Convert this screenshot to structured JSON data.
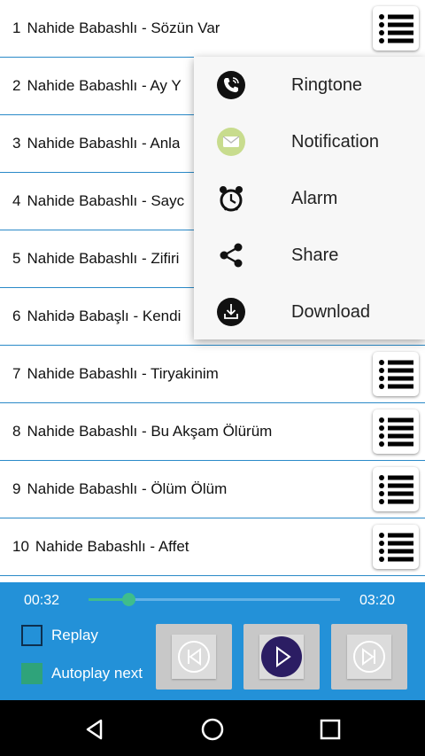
{
  "songs": [
    {
      "num": "1",
      "title": "Nahide Babashlı - Sözün Var"
    },
    {
      "num": "2",
      "title": "Nahide Babashlı - Ay Y"
    },
    {
      "num": "3",
      "title": "Nahide Babashlı - Anla"
    },
    {
      "num": "4",
      "title": "Nahide Babashlı - Sayc"
    },
    {
      "num": "5",
      "title": "Nahide Babashlı - Zifiri"
    },
    {
      "num": "6",
      "title": "Nahidə Babaşlı - Kendi"
    },
    {
      "num": "7",
      "title": "Nahide Babashlı - Tiryakinim"
    },
    {
      "num": "8",
      "title": "Nahide Babashlı - Bu Akşam Ölürüm"
    },
    {
      "num": "9",
      "title": "Nahide Babashlı - Ölüm Ölüm"
    },
    {
      "num": "10",
      "title": "Nahide Babashlı - Affet"
    }
  ],
  "popup_menu": {
    "items": [
      {
        "label": "Ringtone",
        "icon": "phone-icon"
      },
      {
        "label": "Notification",
        "icon": "envelope-icon"
      },
      {
        "label": "Alarm",
        "icon": "alarm-clock-icon"
      },
      {
        "label": "Share",
        "icon": "share-icon"
      },
      {
        "label": "Download",
        "icon": "download-icon"
      }
    ]
  },
  "player": {
    "elapsed": "00:32",
    "duration": "03:20",
    "progress": 0.16,
    "replay_label": "Replay",
    "replay_checked": false,
    "autoplay_label": "Autoplay next",
    "autoplay_checked": true
  },
  "colors": {
    "accent": "#2391d8",
    "divider": "#2a8ac8",
    "seek": "#3fbd8c",
    "play_button": "#2b1d63"
  }
}
